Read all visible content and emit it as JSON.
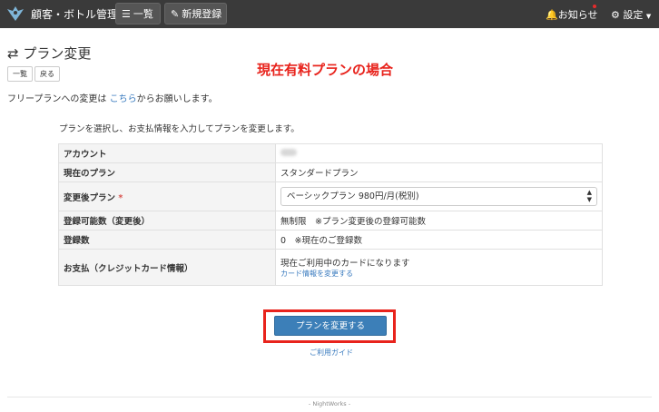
{
  "navbar": {
    "app_title": "顧客・ボトル管理",
    "list_label": "一覧",
    "new_label": "新規登録",
    "notice_label": "お知らせ",
    "settings_label": "設定"
  },
  "page": {
    "title": "プラン変更",
    "list_button": "一覧",
    "back_button": "戻る",
    "annotation": "現在有料プランの場合",
    "free_note_prefix": "フリープランへの変更は",
    "free_note_link": "こちら",
    "free_note_suffix": "からお願いします。",
    "instruction": "プランを選択し、お支払情報を入力してプランを変更します。"
  },
  "table": {
    "account_label": "アカウント",
    "current_plan_label": "現在のプラン",
    "current_plan_value": "スタンダードプラン",
    "new_plan_label": "変更後プラン",
    "required_mark": "*",
    "new_plan_selected": "ベーシックプラン 980円/月(税別)",
    "capacity_label": "登録可能数（変更後）",
    "capacity_value": "無制限　※プラン変更後の登録可能数",
    "registered_label": "登録数",
    "registered_value": "0　※現在のご登録数",
    "payment_label": "お支払（クレジットカード情報）",
    "payment_value": "現在ご利用中のカードになります",
    "payment_link": "カード情報を変更する"
  },
  "actions": {
    "submit": "プランを変更する",
    "guide": "ご利用ガイド"
  },
  "footer": {
    "text": "- NightWorks -"
  },
  "colors": {
    "navbar_bg": "#3a3a3a",
    "primary": "#3c7fb8",
    "annotation_red": "#e8231c",
    "link": "#3a7bbf"
  }
}
